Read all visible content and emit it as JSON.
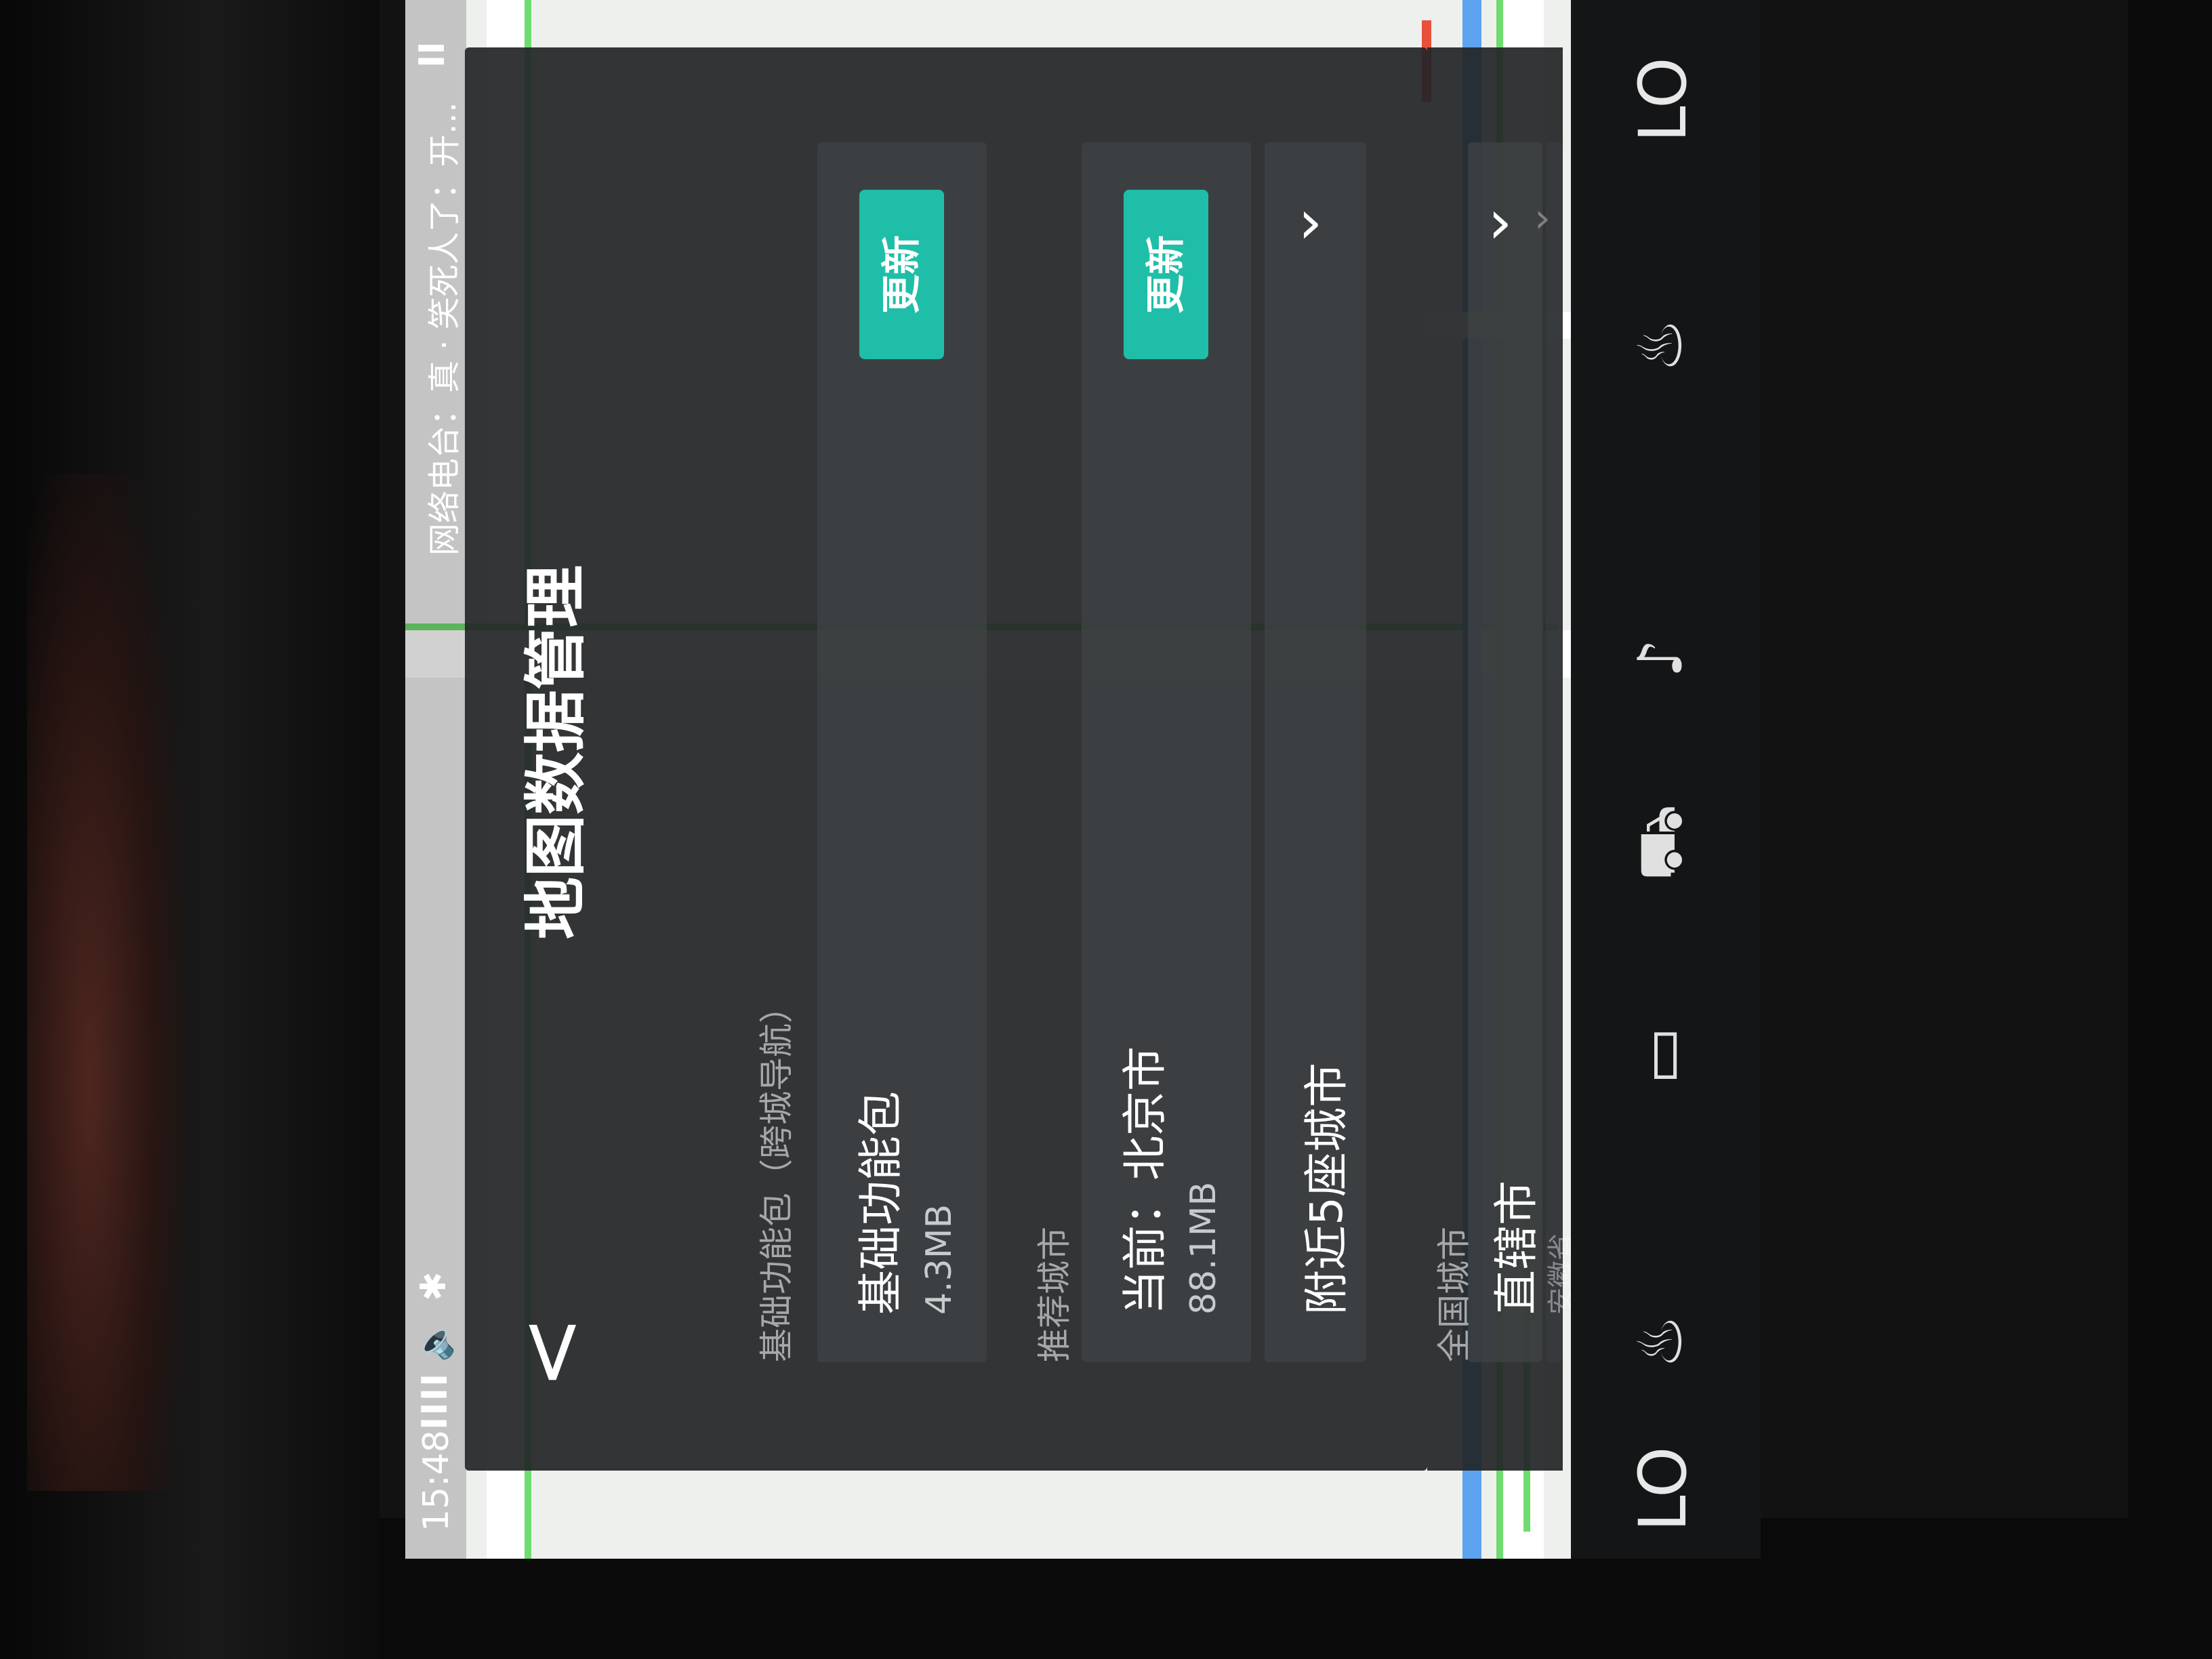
{
  "status_bar": {
    "time": "15:48",
    "signal": "IIII",
    "volume_icon": "speaker-icon",
    "bluetooth_icon": "bluetooth-icon",
    "radio": "网络电台：真 · 笑死人了：开…",
    "pause": "II"
  },
  "panel": {
    "title": "地图数据管理",
    "section_basic": "基础功能包（跨城导航）",
    "basic_pkg": {
      "name": "基础功能包",
      "size": "4.3MB",
      "button": "更新"
    },
    "section_recommended": "推荐城市",
    "current_city": {
      "name": "当前：北京市",
      "size": "88.1MB",
      "button": "更新"
    },
    "nearby": {
      "name": "附近5座城市"
    },
    "section_all": "全国城市",
    "municipality": {
      "name": "直辖市"
    },
    "anhui": {
      "name": "安徽省"
    }
  },
  "dock": {
    "left_temp": "LO",
    "right_temp": "LO"
  },
  "colors": {
    "accent": "#1fbea8",
    "panel": "#242628",
    "map_green": "#6fdc6f"
  }
}
